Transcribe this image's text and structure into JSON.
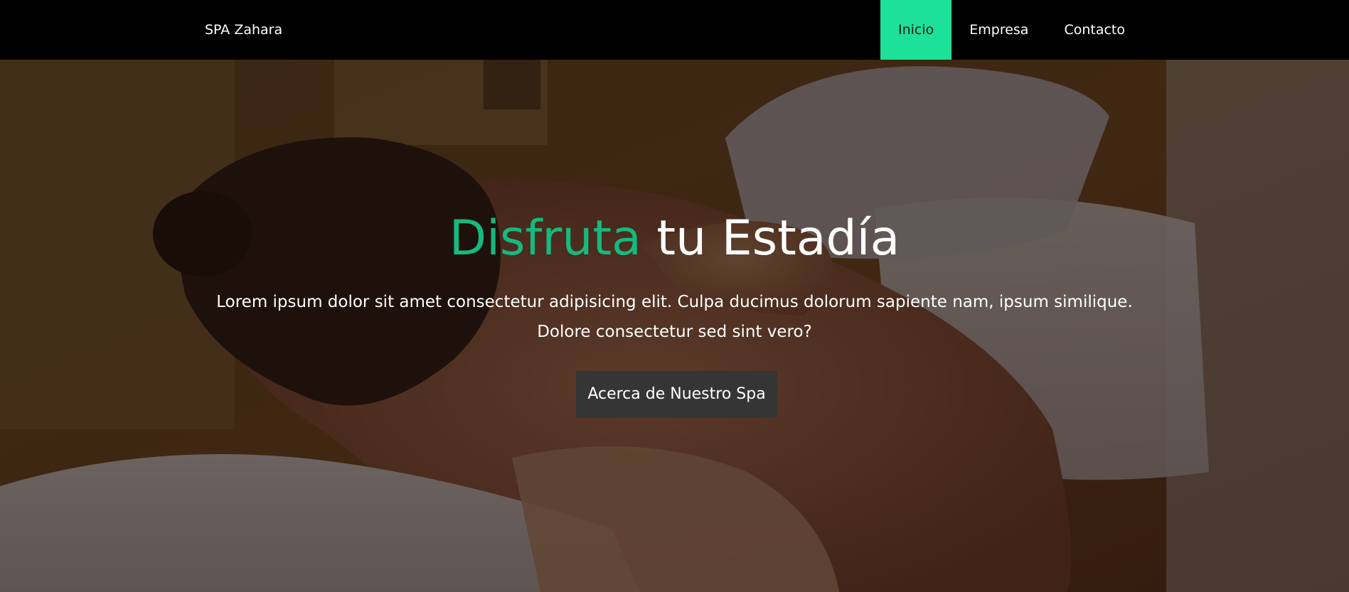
{
  "navbar": {
    "brand": "SPA Zahara",
    "items": [
      {
        "label": "Inicio",
        "active": true
      },
      {
        "label": "Empresa",
        "active": false
      },
      {
        "label": "Contacto",
        "active": false
      }
    ]
  },
  "hero": {
    "title_accent": "Disfruta",
    "title_rest": "tu Estadía",
    "text": "Lorem ipsum dolor sit amet consectetur adipisicing elit. Culpa ducimus dolorum sapiente nam, ipsum similique. Dolore consectetur sed sint vero?",
    "button_label": "Acerca de Nuestro Spa"
  },
  "colors": {
    "accent": "#16b97e",
    "nav_active": "#1de099",
    "button": "#353535",
    "navbar": "#000000"
  }
}
